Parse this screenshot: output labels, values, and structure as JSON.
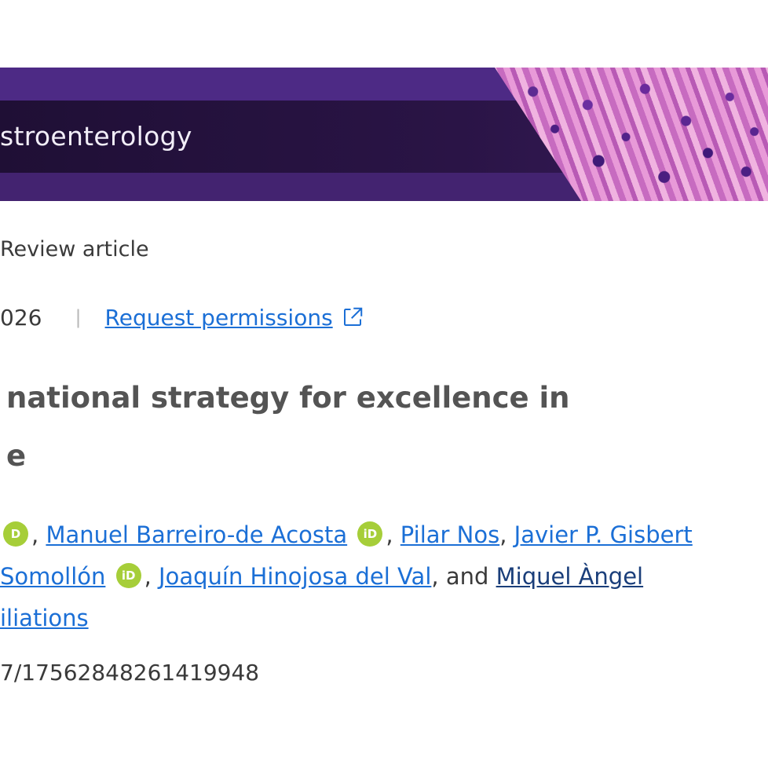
{
  "banner": {
    "journal_name": "stroenterology"
  },
  "article": {
    "type": "Review article",
    "date_fragment": "026",
    "request_permissions": "Request permissions",
    "title_line1": " national strategy for excellence in",
    "title_line2": "e"
  },
  "authors": {
    "lead_fragment": "D",
    "names": [
      "Manuel Barreiro-de Acosta",
      "Pilar Nos",
      "Javier P. Gisbert",
      "Somollón",
      "Joaquín Hinojosa del Val",
      "Miquel Àngel"
    ],
    "and": ", and ",
    "affiliations": "iliations",
    "orcid_label": "iD"
  },
  "doi": "7/17562848261419948",
  "colors": {
    "link": "#1b6fd6",
    "orcid": "#a6ce39",
    "banner": "#3f1c66"
  }
}
